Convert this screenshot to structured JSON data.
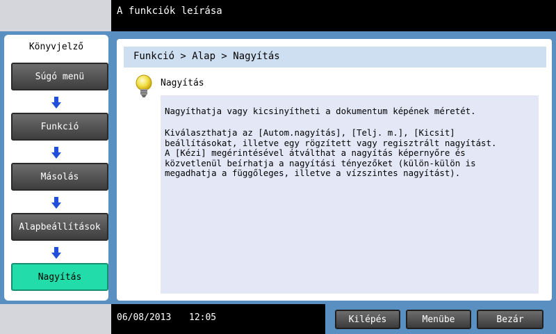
{
  "window": {
    "title": "A funkciók leírása"
  },
  "sidebar": {
    "title": "Könyvjelző",
    "items": [
      {
        "label": "Súgó menü"
      },
      {
        "label": "Funkció"
      },
      {
        "label": "Másolás"
      },
      {
        "label": "Alapbeállítások"
      },
      {
        "label": "Nagyítás",
        "active": true
      }
    ]
  },
  "content": {
    "breadcrumb": "Funkció > Alap > Nagyítás",
    "heading": "Nagyítás",
    "heading_icon": "lightbulb-icon",
    "paragraph1": "Nagyíthatja vagy kicsinyítheti a dokumentum képének méretét.",
    "paragraph2_lines": [
      "Kiválaszthatja az [Autom.nagyítás], [Telj. m.], [Kicsit]",
      "beállításokat, illetve egy rögzített vagy regisztrált nagyítást.",
      "A [Kézi] megérintésével átválthat a nagyítás képernyőre és",
      "közvetlenül beírhatja a nagyítási tényezőket (külön-külön is",
      "megadhatja a függőleges, illetve a vízszintes nagyítást)."
    ]
  },
  "status": {
    "date": "06/08/2013",
    "time": "12:05"
  },
  "buttons": {
    "exit": "Kilépés",
    "menu": "Menübe",
    "close": "Bezár"
  },
  "colors": {
    "frame": "#5a8fc2",
    "active": "#22ddaa",
    "breadcrumb_bg": "#cfdff2",
    "text_bg": "#e3e7f6"
  }
}
